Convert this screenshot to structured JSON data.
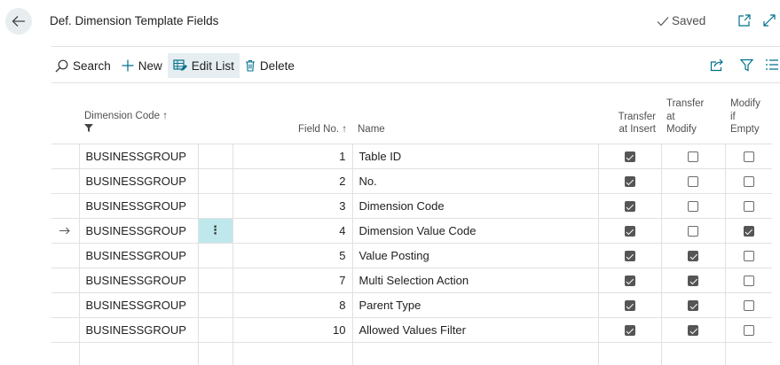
{
  "header": {
    "title": "Def. Dimension Template Fields",
    "saved_label": "Saved"
  },
  "toolbar": {
    "search_label": "Search",
    "new_label": "New",
    "edit_list_label": "Edit List",
    "delete_label": "Delete"
  },
  "table": {
    "columns": {
      "dimension_code": "Dimension Code ↑",
      "field_no": "Field No. ↑",
      "name": "Name",
      "transfer_at_insert_1": "Transfer",
      "transfer_at_insert_2": "at Insert",
      "transfer_at_modify_1": "Transfer",
      "transfer_at_modify_2": "at",
      "transfer_at_modify_3": "Modify",
      "modify_if_empty_1": "Modify if",
      "modify_if_empty_2": "Empty"
    },
    "rows": [
      {
        "dimension_code": "BUSINESSGROUP",
        "field_no": "1",
        "name": "Table ID",
        "transfer_at_insert": true,
        "transfer_at_modify": false,
        "modify_if_empty": false,
        "selected": false
      },
      {
        "dimension_code": "BUSINESSGROUP",
        "field_no": "2",
        "name": "No.",
        "transfer_at_insert": true,
        "transfer_at_modify": false,
        "modify_if_empty": false,
        "selected": false
      },
      {
        "dimension_code": "BUSINESSGROUP",
        "field_no": "3",
        "name": "Dimension Code",
        "transfer_at_insert": true,
        "transfer_at_modify": false,
        "modify_if_empty": false,
        "selected": false
      },
      {
        "dimension_code": "BUSINESSGROUP",
        "field_no": "4",
        "name": "Dimension Value Code",
        "transfer_at_insert": true,
        "transfer_at_modify": false,
        "modify_if_empty": true,
        "selected": true
      },
      {
        "dimension_code": "BUSINESSGROUP",
        "field_no": "5",
        "name": "Value Posting",
        "transfer_at_insert": true,
        "transfer_at_modify": true,
        "modify_if_empty": false,
        "selected": false
      },
      {
        "dimension_code": "BUSINESSGROUP",
        "field_no": "7",
        "name": "Multi Selection Action",
        "transfer_at_insert": true,
        "transfer_at_modify": true,
        "modify_if_empty": false,
        "selected": false
      },
      {
        "dimension_code": "BUSINESSGROUP",
        "field_no": "8",
        "name": "Parent Type",
        "transfer_at_insert": true,
        "transfer_at_modify": true,
        "modify_if_empty": false,
        "selected": false
      },
      {
        "dimension_code": "BUSINESSGROUP",
        "field_no": "10",
        "name": "Allowed Values Filter",
        "transfer_at_insert": true,
        "transfer_at_modify": true,
        "modify_if_empty": false,
        "selected": false
      }
    ]
  },
  "icons": {
    "back": "arrow-left-icon",
    "saved": "checkmark-icon",
    "open_new_window": "open-in-new-window-icon",
    "expand": "expand-icon",
    "search": "search-icon",
    "new": "plus-icon",
    "edit_list": "edit-list-icon",
    "delete": "trash-icon",
    "share": "share-icon",
    "filter": "filter-icon",
    "list_view": "list-view-icon",
    "row_actions": "more-vertical-icon",
    "row_selected": "arrow-right-icon"
  },
  "colors": {
    "accent": "#00718c",
    "selected_cell": "#bfe8ec",
    "toolbar_active": "#e6eef2"
  }
}
